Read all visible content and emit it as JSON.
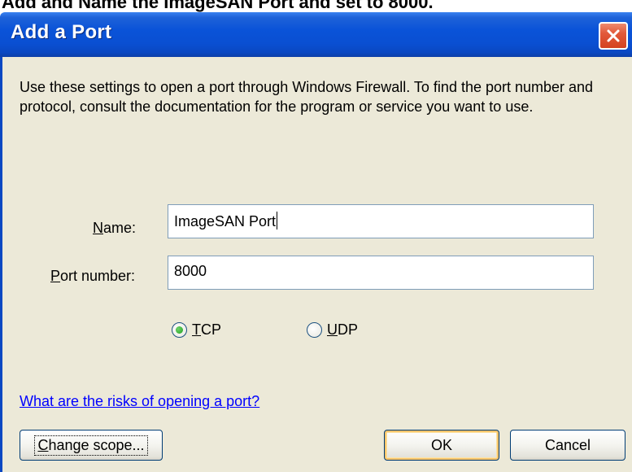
{
  "caption": "Add and Name the ImageSAN Port and set to 8000.",
  "window": {
    "title": "Add a Port"
  },
  "description": "Use these settings to open a port through Windows Firewall. To find the port number and protocol, consult the documentation for the program or service you want to use.",
  "form": {
    "name_label_key": "N",
    "name_label_rest": "ame:",
    "name_value": "ImageSAN Port",
    "port_label_key": "P",
    "port_label_rest": "ort number:",
    "port_value": "8000"
  },
  "protocol": {
    "tcp_key": "T",
    "tcp_rest": "CP",
    "udp_key": "U",
    "udp_rest": "DP",
    "selected": "TCP"
  },
  "risks_link": "What are the risks of opening a port?",
  "buttons": {
    "change_scope_key": "C",
    "change_scope_rest": "hange scope...",
    "ok": "OK",
    "cancel": "Cancel"
  },
  "colors": {
    "titlebar": "#0a53d8",
    "dialog_bg": "#ece9d8",
    "close": "#e2593a",
    "link": "#0000ff"
  },
  "icons": {
    "close": "close-x-icon",
    "radio": "radio-icon"
  }
}
